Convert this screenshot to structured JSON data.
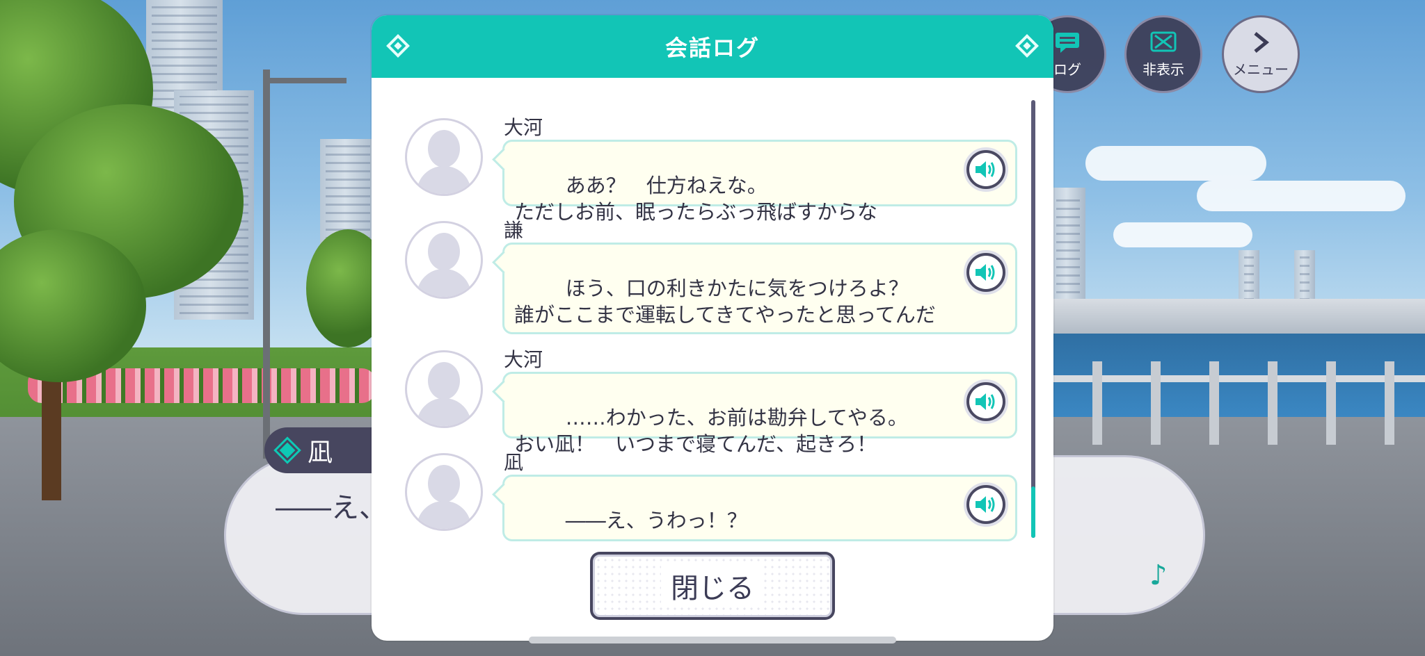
{
  "modal": {
    "title": "会話ログ",
    "close_label": "閉じる",
    "entries": [
      {
        "speaker": "大河",
        "text": "ああ？　仕方ねえな。\nただしお前、眠ったらぶっ飛ばすからな"
      },
      {
        "speaker": "謙",
        "text": "ほう、口の利きかたに気をつけろよ？\n誰がここまで運転してきてやったと思ってんだ"
      },
      {
        "speaker": "大河",
        "text": "……わかった、お前は勘弁してやる。\nおい凪！　いつまで寝てんだ、起きろ！"
      },
      {
        "speaker": "凪",
        "text": "――え、うわっ！？"
      }
    ]
  },
  "hud": {
    "log_label": "ログ",
    "hide_label": "非表示",
    "menu_label": "メニュー"
  },
  "dialog": {
    "speaker": "凪",
    "text": "――え、"
  },
  "colors": {
    "accent": "#12c5b6",
    "dark": "#47465f",
    "bubble": "#fffff0"
  }
}
